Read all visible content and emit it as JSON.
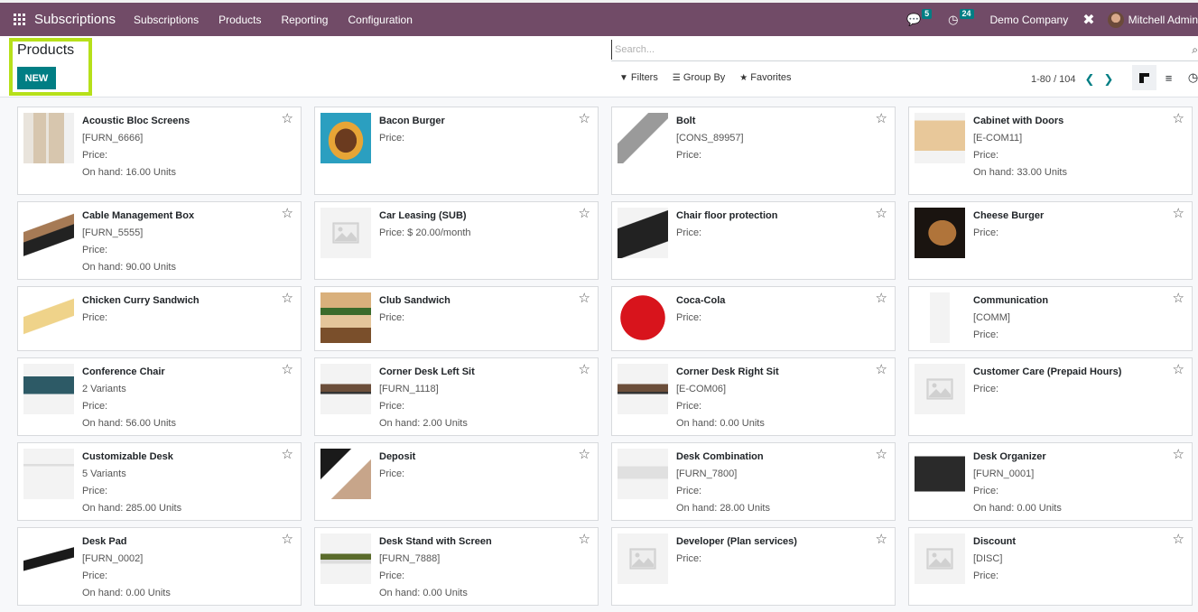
{
  "navbar": {
    "app_name": "Subscriptions",
    "menu": [
      "Subscriptions",
      "Products",
      "Reporting",
      "Configuration"
    ],
    "messages_count": "5",
    "activities_count": "24",
    "company": "Demo Company",
    "user": "Mitchell Admin",
    "colors": {
      "bar": "#714b67",
      "badge": "#017e84"
    }
  },
  "control_panel": {
    "title": "Products",
    "new_label": "NEW",
    "search_placeholder": "Search...",
    "filters_label": "Filters",
    "group_by_label": "Group By",
    "favorites_label": "Favorites",
    "pager": "1-80 / 104",
    "highlight_color": "#b6e01a"
  },
  "products": [
    {
      "name": "Acoustic Bloc Screens",
      "lines": [
        "[FURN_6666]",
        "Price:",
        "On hand: 16.00 Units"
      ],
      "image": "acoustic-screens-image"
    },
    {
      "name": "Bacon Burger",
      "lines": [
        "Price:"
      ],
      "image": "bacon-burger-image"
    },
    {
      "name": "Bolt",
      "lines": [
        "[CONS_89957]",
        "Price:"
      ],
      "image": "bolt-image"
    },
    {
      "name": "Cabinet with Doors",
      "lines": [
        "[E-COM11]",
        "Price:",
        "On hand: 33.00 Units"
      ],
      "image": "cabinet-image"
    },
    {
      "name": "Cable Management Box",
      "lines": [
        "[FURN_5555]",
        "Price:",
        "On hand: 90.00 Units"
      ],
      "image": "cable-box-image"
    },
    {
      "name": "Car Leasing (SUB)",
      "lines": [
        "Price: $ 20.00/month"
      ],
      "image": "placeholder"
    },
    {
      "name": "Chair floor protection",
      "lines": [
        "Price:"
      ],
      "image": "chair-floor-image"
    },
    {
      "name": "Cheese Burger",
      "lines": [
        "Price:"
      ],
      "image": "cheese-burger-image"
    },
    {
      "name": "Chicken Curry Sandwich",
      "lines": [
        "Price:"
      ],
      "image": "sandwich-image"
    },
    {
      "name": "Club Sandwich",
      "lines": [
        "Price:"
      ],
      "image": "club-sandwich-image"
    },
    {
      "name": "Coca-Cola",
      "lines": [
        "Price:"
      ],
      "image": "coca-cola-image"
    },
    {
      "name": "Communication",
      "lines": [
        "[COMM]",
        "Price:"
      ],
      "image": "phone-dollar-image"
    },
    {
      "name": "Conference Chair",
      "lines": [
        "2 Variants",
        "Price:",
        "On hand: 56.00 Units"
      ],
      "image": "chair-image"
    },
    {
      "name": "Corner Desk Left Sit",
      "lines": [
        "[FURN_1118]",
        "Price:",
        "On hand: 2.00 Units"
      ],
      "image": "corner-desk-image"
    },
    {
      "name": "Corner Desk Right Sit",
      "lines": [
        "[E-COM06]",
        "Price:",
        "On hand: 0.00 Units"
      ],
      "image": "corner-desk-image"
    },
    {
      "name": "Customer Care (Prepaid Hours)",
      "lines": [
        "Price:"
      ],
      "image": "placeholder"
    },
    {
      "name": "Customizable Desk",
      "lines": [
        "5 Variants",
        "Price:",
        "On hand: 285.00 Units"
      ],
      "image": "desk-image"
    },
    {
      "name": "Deposit",
      "lines": [
        "Price:"
      ],
      "image": "deposit-image"
    },
    {
      "name": "Desk Combination",
      "lines": [
        "[FURN_7800]",
        "Price:",
        "On hand: 28.00 Units"
      ],
      "image": "desk-combination-image"
    },
    {
      "name": "Desk Organizer",
      "lines": [
        "[FURN_0001]",
        "Price:",
        "On hand: 0.00 Units"
      ],
      "image": "desk-organizer-image"
    },
    {
      "name": "Desk Pad",
      "lines": [
        "[FURN_0002]",
        "Price:",
        "On hand: 0.00 Units"
      ],
      "image": "desk-pad-image"
    },
    {
      "name": "Desk Stand with Screen",
      "lines": [
        "[FURN_7888]",
        "Price:",
        "On hand: 0.00 Units"
      ],
      "image": "desk-stand-image"
    },
    {
      "name": "Developer (Plan services)",
      "lines": [
        "Price:"
      ],
      "image": "placeholder"
    },
    {
      "name": "Discount",
      "lines": [
        "[DISC]",
        "Price:"
      ],
      "image": "placeholder"
    }
  ]
}
